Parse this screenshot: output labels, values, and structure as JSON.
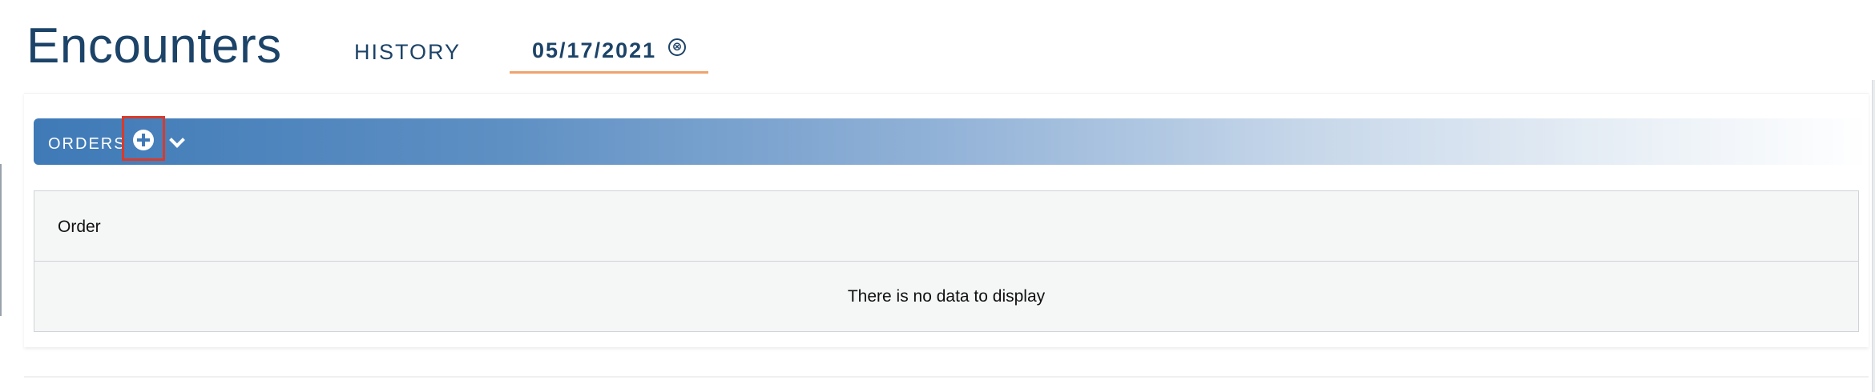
{
  "header": {
    "title": "Encounters",
    "tabs": [
      {
        "label": "HISTORY"
      },
      {
        "label": "05/17/2021",
        "close_glyph": "⊗",
        "active": true
      }
    ]
  },
  "orders": {
    "label": "ORDERS",
    "add_icon": "plus-circle-icon",
    "toggle_icon": "chevron-down-icon"
  },
  "table": {
    "columns": [
      "Order"
    ],
    "empty_message": "There is no data to display"
  },
  "colors": {
    "title": "#1c4368",
    "active_tab_underline": "#f0a36c",
    "bar_start": "#3f7ab7",
    "highlight": "#d93a2b"
  }
}
